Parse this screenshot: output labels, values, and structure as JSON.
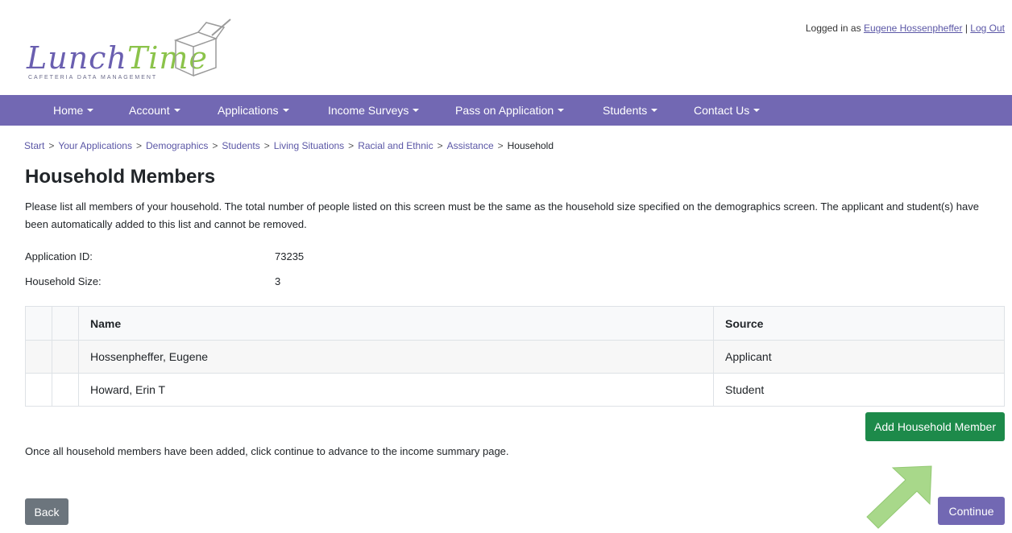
{
  "header": {
    "logo_text_1": "Lunch",
    "logo_text_2": "Time",
    "logo_subtitle": "CAFETERIA DATA MANAGEMENT",
    "logged_in_prefix": "Logged in as",
    "user_name": "Eugene Hossenpheffer",
    "separator": "|",
    "logout_label": "Log Out"
  },
  "nav": {
    "items": [
      {
        "label": "Home"
      },
      {
        "label": "Account"
      },
      {
        "label": "Applications"
      },
      {
        "label": "Income Surveys"
      },
      {
        "label": "Pass on Application"
      },
      {
        "label": "Students"
      },
      {
        "label": "Contact Us"
      }
    ],
    "color": "#7268b3"
  },
  "breadcrumb": {
    "items": [
      "Start",
      "Your Applications",
      "Demographics",
      "Students",
      "Living Situations",
      "Racial and Ethnic",
      "Assistance"
    ],
    "current": "Household",
    "separator": ">"
  },
  "page": {
    "title": "Household Members",
    "intro": "Please list all members of your household. The total number of people listed on this screen must be the same as the household size specified on the demographics screen. The applicant and student(s) have been automatically added to this list and cannot be removed.",
    "application_id_label": "Application ID:",
    "application_id": "73235",
    "household_size_label": "Household Size:",
    "household_size": "3",
    "outro": "Once all household members have been added, click continue to advance to the income summary page."
  },
  "table": {
    "columns": [
      "Name",
      "Source"
    ],
    "rows": [
      {
        "name": "Hossenpheffer, Eugene",
        "source": "Applicant"
      },
      {
        "name": "Howard, Erin T",
        "source": "Student"
      }
    ]
  },
  "buttons": {
    "add_member": "Add Household Member",
    "back": "Back",
    "continue": "Continue"
  },
  "colors": {
    "primary": "#7268b3",
    "success": "#1d8a4a",
    "secondary": "#6c757d",
    "arrow": "#a8d88a"
  }
}
